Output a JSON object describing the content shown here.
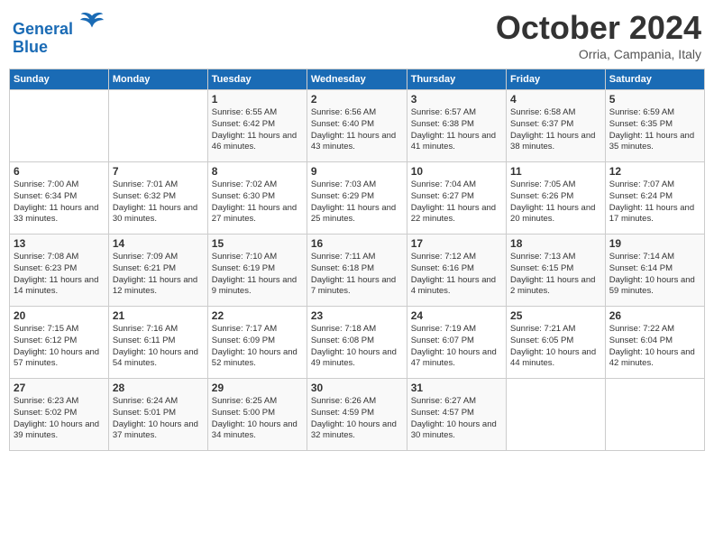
{
  "header": {
    "logo_line1": "General",
    "logo_line2": "Blue",
    "month": "October 2024",
    "location": "Orria, Campania, Italy"
  },
  "weekdays": [
    "Sunday",
    "Monday",
    "Tuesday",
    "Wednesday",
    "Thursday",
    "Friday",
    "Saturday"
  ],
  "weeks": [
    [
      {
        "day": "",
        "detail": ""
      },
      {
        "day": "",
        "detail": ""
      },
      {
        "day": "1",
        "detail": "Sunrise: 6:55 AM\nSunset: 6:42 PM\nDaylight: 11 hours and 46 minutes."
      },
      {
        "day": "2",
        "detail": "Sunrise: 6:56 AM\nSunset: 6:40 PM\nDaylight: 11 hours and 43 minutes."
      },
      {
        "day": "3",
        "detail": "Sunrise: 6:57 AM\nSunset: 6:38 PM\nDaylight: 11 hours and 41 minutes."
      },
      {
        "day": "4",
        "detail": "Sunrise: 6:58 AM\nSunset: 6:37 PM\nDaylight: 11 hours and 38 minutes."
      },
      {
        "day": "5",
        "detail": "Sunrise: 6:59 AM\nSunset: 6:35 PM\nDaylight: 11 hours and 35 minutes."
      }
    ],
    [
      {
        "day": "6",
        "detail": "Sunrise: 7:00 AM\nSunset: 6:34 PM\nDaylight: 11 hours and 33 minutes."
      },
      {
        "day": "7",
        "detail": "Sunrise: 7:01 AM\nSunset: 6:32 PM\nDaylight: 11 hours and 30 minutes."
      },
      {
        "day": "8",
        "detail": "Sunrise: 7:02 AM\nSunset: 6:30 PM\nDaylight: 11 hours and 27 minutes."
      },
      {
        "day": "9",
        "detail": "Sunrise: 7:03 AM\nSunset: 6:29 PM\nDaylight: 11 hours and 25 minutes."
      },
      {
        "day": "10",
        "detail": "Sunrise: 7:04 AM\nSunset: 6:27 PM\nDaylight: 11 hours and 22 minutes."
      },
      {
        "day": "11",
        "detail": "Sunrise: 7:05 AM\nSunset: 6:26 PM\nDaylight: 11 hours and 20 minutes."
      },
      {
        "day": "12",
        "detail": "Sunrise: 7:07 AM\nSunset: 6:24 PM\nDaylight: 11 hours and 17 minutes."
      }
    ],
    [
      {
        "day": "13",
        "detail": "Sunrise: 7:08 AM\nSunset: 6:23 PM\nDaylight: 11 hours and 14 minutes."
      },
      {
        "day": "14",
        "detail": "Sunrise: 7:09 AM\nSunset: 6:21 PM\nDaylight: 11 hours and 12 minutes."
      },
      {
        "day": "15",
        "detail": "Sunrise: 7:10 AM\nSunset: 6:19 PM\nDaylight: 11 hours and 9 minutes."
      },
      {
        "day": "16",
        "detail": "Sunrise: 7:11 AM\nSunset: 6:18 PM\nDaylight: 11 hours and 7 minutes."
      },
      {
        "day": "17",
        "detail": "Sunrise: 7:12 AM\nSunset: 6:16 PM\nDaylight: 11 hours and 4 minutes."
      },
      {
        "day": "18",
        "detail": "Sunrise: 7:13 AM\nSunset: 6:15 PM\nDaylight: 11 hours and 2 minutes."
      },
      {
        "day": "19",
        "detail": "Sunrise: 7:14 AM\nSunset: 6:14 PM\nDaylight: 10 hours and 59 minutes."
      }
    ],
    [
      {
        "day": "20",
        "detail": "Sunrise: 7:15 AM\nSunset: 6:12 PM\nDaylight: 10 hours and 57 minutes."
      },
      {
        "day": "21",
        "detail": "Sunrise: 7:16 AM\nSunset: 6:11 PM\nDaylight: 10 hours and 54 minutes."
      },
      {
        "day": "22",
        "detail": "Sunrise: 7:17 AM\nSunset: 6:09 PM\nDaylight: 10 hours and 52 minutes."
      },
      {
        "day": "23",
        "detail": "Sunrise: 7:18 AM\nSunset: 6:08 PM\nDaylight: 10 hours and 49 minutes."
      },
      {
        "day": "24",
        "detail": "Sunrise: 7:19 AM\nSunset: 6:07 PM\nDaylight: 10 hours and 47 minutes."
      },
      {
        "day": "25",
        "detail": "Sunrise: 7:21 AM\nSunset: 6:05 PM\nDaylight: 10 hours and 44 minutes."
      },
      {
        "day": "26",
        "detail": "Sunrise: 7:22 AM\nSunset: 6:04 PM\nDaylight: 10 hours and 42 minutes."
      }
    ],
    [
      {
        "day": "27",
        "detail": "Sunrise: 6:23 AM\nSunset: 5:02 PM\nDaylight: 10 hours and 39 minutes."
      },
      {
        "day": "28",
        "detail": "Sunrise: 6:24 AM\nSunset: 5:01 PM\nDaylight: 10 hours and 37 minutes."
      },
      {
        "day": "29",
        "detail": "Sunrise: 6:25 AM\nSunset: 5:00 PM\nDaylight: 10 hours and 34 minutes."
      },
      {
        "day": "30",
        "detail": "Sunrise: 6:26 AM\nSunset: 4:59 PM\nDaylight: 10 hours and 32 minutes."
      },
      {
        "day": "31",
        "detail": "Sunrise: 6:27 AM\nSunset: 4:57 PM\nDaylight: 10 hours and 30 minutes."
      },
      {
        "day": "",
        "detail": ""
      },
      {
        "day": "",
        "detail": ""
      }
    ]
  ]
}
